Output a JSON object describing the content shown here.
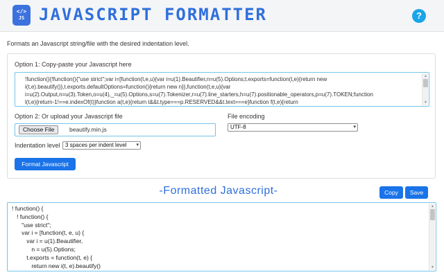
{
  "header": {
    "logo_top": "</>",
    "logo_bottom": "JS",
    "title": "Javascript Formatter",
    "help": "?"
  },
  "intro": "Formats an Javascript string/file with the desired indentation level.",
  "input": {
    "option1_label": "Option 1: Copy-paste your Javascript here",
    "textarea_lines": [
      "!function(){!function(){\"use strict\";var i=[function(t,e,u){var i=u(1).Beautifier,n=u(5).Options;t.exports=function(t,e){return new",
      "i(t,e).beautify()},t.exports.defaultOptions=function(){return new n}},function(t,e,u){var",
      "i=u(2).Output,n=u(3).Token,o=u(4),_=u(5).Options,s=u(7).Tokenizer,r=u(7).line_starters,h=u(7).positionable_operators,p=u(7).TOKEN;function",
      "l(t,e){return-1!==e.indexOf(t)}function a(t,e){return t&&t.type===p.RESERVED&&t.text===e}function f(t,e){return"
    ],
    "option2_label": "Option 2: Or upload your Javascript file",
    "choose_file": "Choose File",
    "file_name": "beautify.min.js",
    "encoding_label": "File encoding",
    "encoding_value": "UTF-8",
    "indent_label": "Indentation level",
    "indent_value": "3 spaces per indent level",
    "format_button": "Format Javascript"
  },
  "output": {
    "title": "-Formatted Javascript-",
    "copy_button": "Copy",
    "save_button": "Save",
    "code_lines": [
      "! function() {",
      "   ! function() {",
      "      \"use strict\";",
      "      var i = [function(t, e, u) {",
      "         var i = u(1).Beautifier,",
      "            n = u(5).Options;",
      "         t.exports = function(t, e) {",
      "            return new i(t, e).beautify()"
    ]
  },
  "colors": {
    "accent": "#2f6fdc",
    "button": "#1a73e8",
    "help": "#19a5e8",
    "field_border": "#73c4e8"
  }
}
